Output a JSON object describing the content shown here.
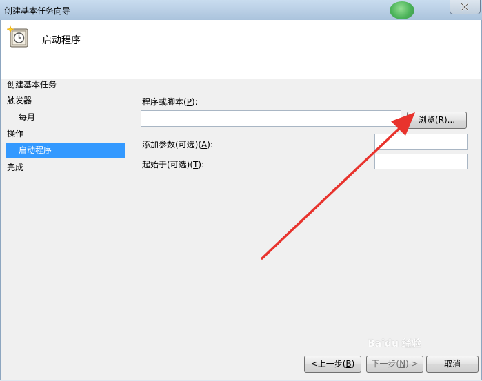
{
  "window": {
    "title": "创建基本任务向导"
  },
  "header": {
    "title": "启动程序"
  },
  "nav": {
    "items": [
      {
        "label": "创建基本任务",
        "selected": false
      },
      {
        "label": "触发器",
        "selected": false
      },
      {
        "label": "每月",
        "selected": false
      },
      {
        "label": "操作",
        "selected": false
      },
      {
        "label": "启动程序",
        "selected": true
      },
      {
        "label": "完成",
        "selected": false
      }
    ]
  },
  "form": {
    "program_label": "程序或脚本(",
    "program_key": "P",
    "program_label_end": "):",
    "program_value": "",
    "browse_label": "浏览(R)...",
    "args_label": "添加参数(可选)(",
    "args_key": "A",
    "args_label_end": "):",
    "args_value": "",
    "start_label": "起始于(可选)(",
    "start_key": "T",
    "start_label_end": "):",
    "start_value": ""
  },
  "footer": {
    "back_label": "<上一步(",
    "back_key": "B",
    "back_end": ")",
    "next_label": "下一步(",
    "next_key": "N",
    "next_end": ") >",
    "cancel_label": "取消"
  },
  "watermark": "Baidu 经验",
  "colors": {
    "selection": "#3399ff",
    "arrow": "#e8332d"
  }
}
